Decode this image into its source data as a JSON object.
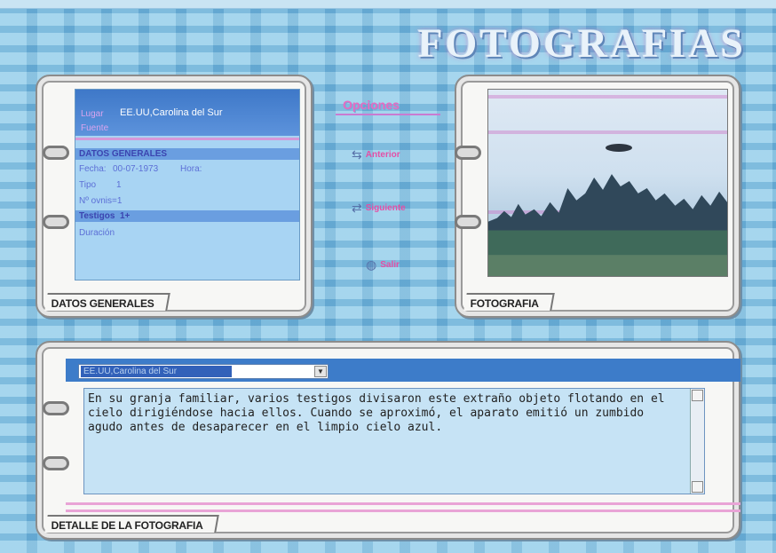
{
  "app": {
    "title": "FOTOGRAFIAS"
  },
  "panels": {
    "datos_tab": "DATOS GENERALES",
    "foto_tab": "FOTOGRAFIA",
    "detalle_tab": "DETALLE DE LA FOTOGRAFIA"
  },
  "datos": {
    "lugar_label": "Lugar",
    "lugar_value": "EE.UU,Carolina del Sur",
    "fuente_label": "Fuente",
    "section_title": "DATOS GENERALES",
    "fecha_label": "Fecha:",
    "fecha_value": "00-07-1973",
    "hora_label": "Hora:",
    "tipo_label": "Tipo",
    "tipo_value": "1",
    "ovnis_label": "Nº ovnis=1",
    "testigos_label": "Testigos",
    "testigos_value": "1+",
    "duracion_label": "Duración"
  },
  "options": {
    "title": "Opciones",
    "anterior": "Anterior",
    "siguiente": "Siguiente",
    "salir": "Salir"
  },
  "detalle": {
    "select_value": "EE.UU,Carolina del Sur",
    "text": "En su granja familiar, varios testigos divisaron este extraño objeto flotando en el cielo dirigiéndose hacia ellos. Cuando se aproximó, el aparato emitió un zumbido agudo antes de desaparecer en el limpio cielo azul."
  },
  "colors": {
    "accent_pink": "#e56bc2",
    "panel_blue": "#3d7cc9",
    "background": "#7fc4e6"
  },
  "icons": {
    "anterior": "arrow-back-icon",
    "siguiente": "arrow-forward-icon",
    "salir": "globe-icon",
    "dropdown": "chevron-down-icon"
  }
}
